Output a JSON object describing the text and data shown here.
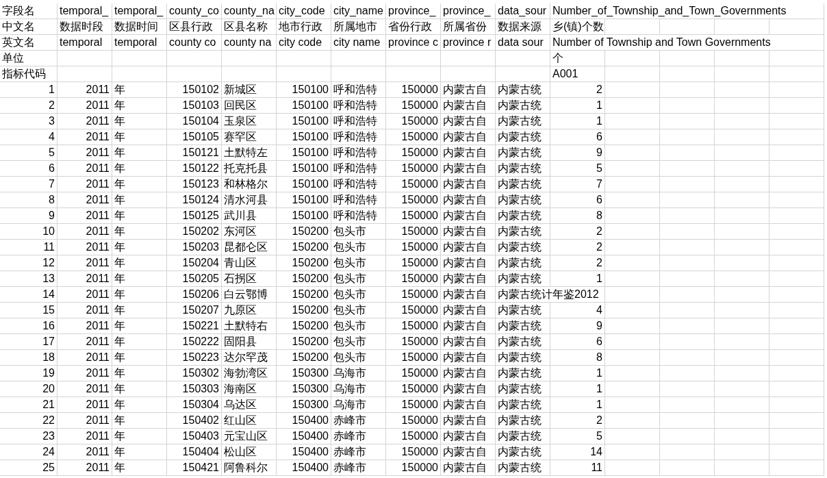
{
  "header_rows": [
    {
      "label": "字段名",
      "fields": [
        "temporal_",
        "temporal_",
        "county_co",
        "county_na",
        "city_code",
        "city_name",
        "province_",
        "province_",
        "data_sour",
        "Number_of_Township_and_Town_Governments"
      ]
    },
    {
      "label": "中文名",
      "fields": [
        "数据时段",
        "数据时间",
        "区县行政",
        "区县名称",
        "地市行政",
        "所属地市",
        "省份行政",
        "所属省份",
        "数据来源",
        "乡(镇)个数"
      ]
    },
    {
      "label": "英文名",
      "fields": [
        "temporal",
        "temporal",
        "county co",
        "county na",
        "city code",
        "city name",
        "province c",
        "province r",
        "data sour",
        "Number of Township and Town Governments"
      ]
    },
    {
      "label": "单位",
      "fields": [
        "个"
      ]
    },
    {
      "label": "指标代码",
      "fields": [
        "A001"
      ]
    }
  ],
  "rows": [
    {
      "index": "1",
      "year": "2011",
      "period": "年",
      "county_code": "150102",
      "county_name": "新城区",
      "city_code": "150100",
      "city_name": "呼和浩特",
      "province_code": "150000",
      "province_name": "内蒙古自",
      "data_source": "内蒙古统",
      "value": "2"
    },
    {
      "index": "2",
      "year": "2011",
      "period": "年",
      "county_code": "150103",
      "county_name": "回民区",
      "city_code": "150100",
      "city_name": "呼和浩特",
      "province_code": "150000",
      "province_name": "内蒙古自",
      "data_source": "内蒙古统",
      "value": "1"
    },
    {
      "index": "3",
      "year": "2011",
      "period": "年",
      "county_code": "150104",
      "county_name": "玉泉区",
      "city_code": "150100",
      "city_name": "呼和浩特",
      "province_code": "150000",
      "province_name": "内蒙古自",
      "data_source": "内蒙古统",
      "value": "1"
    },
    {
      "index": "4",
      "year": "2011",
      "period": "年",
      "county_code": "150105",
      "county_name": "赛罕区",
      "city_code": "150100",
      "city_name": "呼和浩特",
      "province_code": "150000",
      "province_name": "内蒙古自",
      "data_source": "内蒙古统",
      "value": "6"
    },
    {
      "index": "5",
      "year": "2011",
      "period": "年",
      "county_code": "150121",
      "county_name": "土默特左",
      "city_code": "150100",
      "city_name": "呼和浩特",
      "province_code": "150000",
      "province_name": "内蒙古自",
      "data_source": "内蒙古统",
      "value": "9"
    },
    {
      "index": "6",
      "year": "2011",
      "period": "年",
      "county_code": "150122",
      "county_name": "托克托县",
      "city_code": "150100",
      "city_name": "呼和浩特",
      "province_code": "150000",
      "province_name": "内蒙古自",
      "data_source": "内蒙古统",
      "value": "5"
    },
    {
      "index": "7",
      "year": "2011",
      "period": "年",
      "county_code": "150123",
      "county_name": "和林格尔",
      "city_code": "150100",
      "city_name": "呼和浩特",
      "province_code": "150000",
      "province_name": "内蒙古自",
      "data_source": "内蒙古统",
      "value": "7"
    },
    {
      "index": "8",
      "year": "2011",
      "period": "年",
      "county_code": "150124",
      "county_name": "清水河县",
      "city_code": "150100",
      "city_name": "呼和浩特",
      "province_code": "150000",
      "province_name": "内蒙古自",
      "data_source": "内蒙古统",
      "value": "6"
    },
    {
      "index": "9",
      "year": "2011",
      "period": "年",
      "county_code": "150125",
      "county_name": "武川县",
      "city_code": "150100",
      "city_name": "呼和浩特",
      "province_code": "150000",
      "province_name": "内蒙古自",
      "data_source": "内蒙古统",
      "value": "8"
    },
    {
      "index": "10",
      "year": "2011",
      "period": "年",
      "county_code": "150202",
      "county_name": "东河区",
      "city_code": "150200",
      "city_name": "包头市",
      "province_code": "150000",
      "province_name": "内蒙古自",
      "data_source": "内蒙古统",
      "value": "2"
    },
    {
      "index": "11",
      "year": "2011",
      "period": "年",
      "county_code": "150203",
      "county_name": "昆都仑区",
      "city_code": "150200",
      "city_name": "包头市",
      "province_code": "150000",
      "province_name": "内蒙古自",
      "data_source": "内蒙古统",
      "value": "2"
    },
    {
      "index": "12",
      "year": "2011",
      "period": "年",
      "county_code": "150204",
      "county_name": "青山区",
      "city_code": "150200",
      "city_name": "包头市",
      "province_code": "150000",
      "province_name": "内蒙古自",
      "data_source": "内蒙古统",
      "value": "2"
    },
    {
      "index": "13",
      "year": "2011",
      "period": "年",
      "county_code": "150205",
      "county_name": "石拐区",
      "city_code": "150200",
      "city_name": "包头市",
      "province_code": "150000",
      "province_name": "内蒙古自",
      "data_source": "内蒙古统",
      "value": "1"
    },
    {
      "index": "14",
      "year": "2011",
      "period": "年",
      "county_code": "150206",
      "county_name": "白云鄂博",
      "city_code": "150200",
      "city_name": "包头市",
      "province_code": "150000",
      "province_name": "内蒙古自",
      "data_source": "内蒙古统计年鉴2012"
    },
    {
      "index": "15",
      "year": "2011",
      "period": "年",
      "county_code": "150207",
      "county_name": "九原区",
      "city_code": "150200",
      "city_name": "包头市",
      "province_code": "150000",
      "province_name": "内蒙古自",
      "data_source": "内蒙古统",
      "value": "4"
    },
    {
      "index": "16",
      "year": "2011",
      "period": "年",
      "county_code": "150221",
      "county_name": "土默特右",
      "city_code": "150200",
      "city_name": "包头市",
      "province_code": "150000",
      "province_name": "内蒙古自",
      "data_source": "内蒙古统",
      "value": "9"
    },
    {
      "index": "17",
      "year": "2011",
      "period": "年",
      "county_code": "150222",
      "county_name": "固阳县",
      "city_code": "150200",
      "city_name": "包头市",
      "province_code": "150000",
      "province_name": "内蒙古自",
      "data_source": "内蒙古统",
      "value": "6"
    },
    {
      "index": "18",
      "year": "2011",
      "period": "年",
      "county_code": "150223",
      "county_name": "达尔罕茂",
      "city_code": "150200",
      "city_name": "包头市",
      "province_code": "150000",
      "province_name": "内蒙古自",
      "data_source": "内蒙古统",
      "value": "8"
    },
    {
      "index": "19",
      "year": "2011",
      "period": "年",
      "county_code": "150302",
      "county_name": "海勃湾区",
      "city_code": "150300",
      "city_name": "乌海市",
      "province_code": "150000",
      "province_name": "内蒙古自",
      "data_source": "内蒙古统",
      "value": "1"
    },
    {
      "index": "20",
      "year": "2011",
      "period": "年",
      "county_code": "150303",
      "county_name": "海南区",
      "city_code": "150300",
      "city_name": "乌海市",
      "province_code": "150000",
      "province_name": "内蒙古自",
      "data_source": "内蒙古统",
      "value": "1"
    },
    {
      "index": "21",
      "year": "2011",
      "period": "年",
      "county_code": "150304",
      "county_name": "乌达区",
      "city_code": "150300",
      "city_name": "乌海市",
      "province_code": "150000",
      "province_name": "内蒙古自",
      "data_source": "内蒙古统",
      "value": "1"
    },
    {
      "index": "22",
      "year": "2011",
      "period": "年",
      "county_code": "150402",
      "county_name": "红山区",
      "city_code": "150400",
      "city_name": "赤峰市",
      "province_code": "150000",
      "province_name": "内蒙古自",
      "data_source": "内蒙古统",
      "value": "2"
    },
    {
      "index": "23",
      "year": "2011",
      "period": "年",
      "county_code": "150403",
      "county_name": "元宝山区",
      "city_code": "150400",
      "city_name": "赤峰市",
      "province_code": "150000",
      "province_name": "内蒙古自",
      "data_source": "内蒙古统",
      "value": "5"
    },
    {
      "index": "24",
      "year": "2011",
      "period": "年",
      "county_code": "150404",
      "county_name": "松山区",
      "city_code": "150400",
      "city_name": "赤峰市",
      "province_code": "150000",
      "province_name": "内蒙古自",
      "data_source": "内蒙古统",
      "value": "14"
    },
    {
      "index": "25",
      "year": "2011",
      "period": "年",
      "county_code": "150421",
      "county_name": "阿鲁科尔",
      "city_code": "150400",
      "city_name": "赤峰市",
      "province_code": "150000",
      "province_name": "内蒙古自",
      "data_source": "内蒙古统",
      "value": "11"
    }
  ]
}
